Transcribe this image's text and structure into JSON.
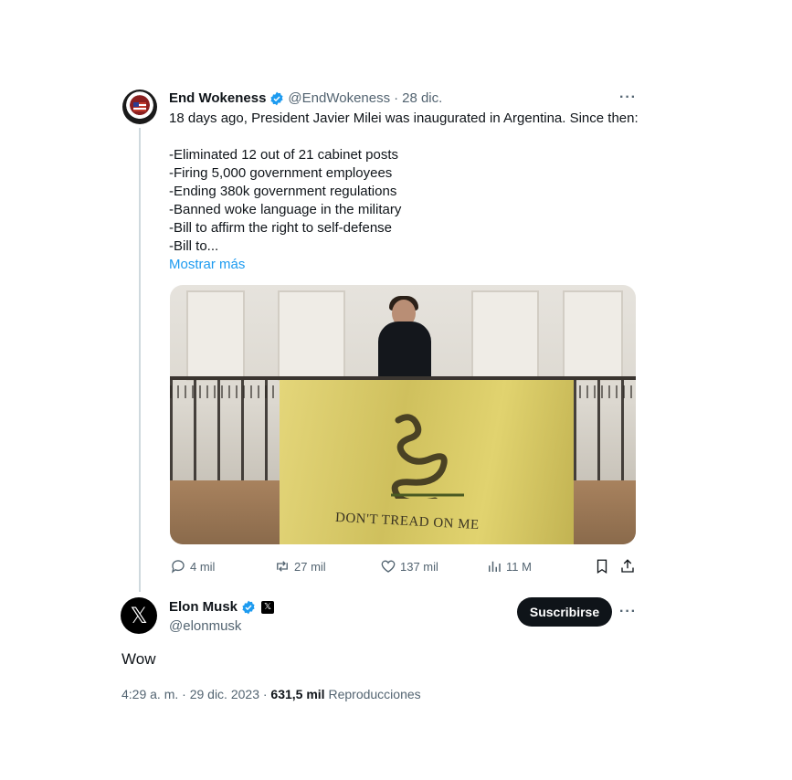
{
  "quoted_tweet": {
    "author_name": "End Wokeness",
    "handle": "@EndWokeness",
    "separator": "·",
    "date": "28 dic.",
    "text": "18 days ago, President Javier Milei was inaugurated in Argentina. Since then:\n\n-Eliminated 12 out of 21 cabinet posts\n-Firing 5,000 government employees\n-Ending 380k government regulations\n-Banned woke language in the military\n-Bill to affirm the right to self-defense\n-Bill to...",
    "show_more_label": "Mostrar más",
    "more_label": "···",
    "flag_text": "DON'T TREAD ON ME",
    "actions": {
      "replies": "4 mil",
      "reposts": "27 mil",
      "likes": "137 mil",
      "views": "11 M"
    }
  },
  "reply_tweet": {
    "author_name": "Elon Musk",
    "handle": "@elonmusk",
    "x_badge": "𝕏",
    "subscribe_label": "Suscribirse",
    "more_label": "···",
    "text": "Wow",
    "time": "4:29 a. m. · 29 dic. 2023 · ",
    "views_count": "631,5 mil",
    "views_label": " Reproducciones"
  },
  "colors": {
    "accent": "#1d9bf0",
    "text": "#0f1419",
    "muted": "#536471",
    "verified": "#1d9bf0"
  },
  "icons": [
    "verified-badge-icon",
    "more-icon",
    "reply-icon",
    "repost-icon",
    "like-icon",
    "views-icon",
    "bookmark-icon",
    "share-icon",
    "x-logo-icon"
  ]
}
